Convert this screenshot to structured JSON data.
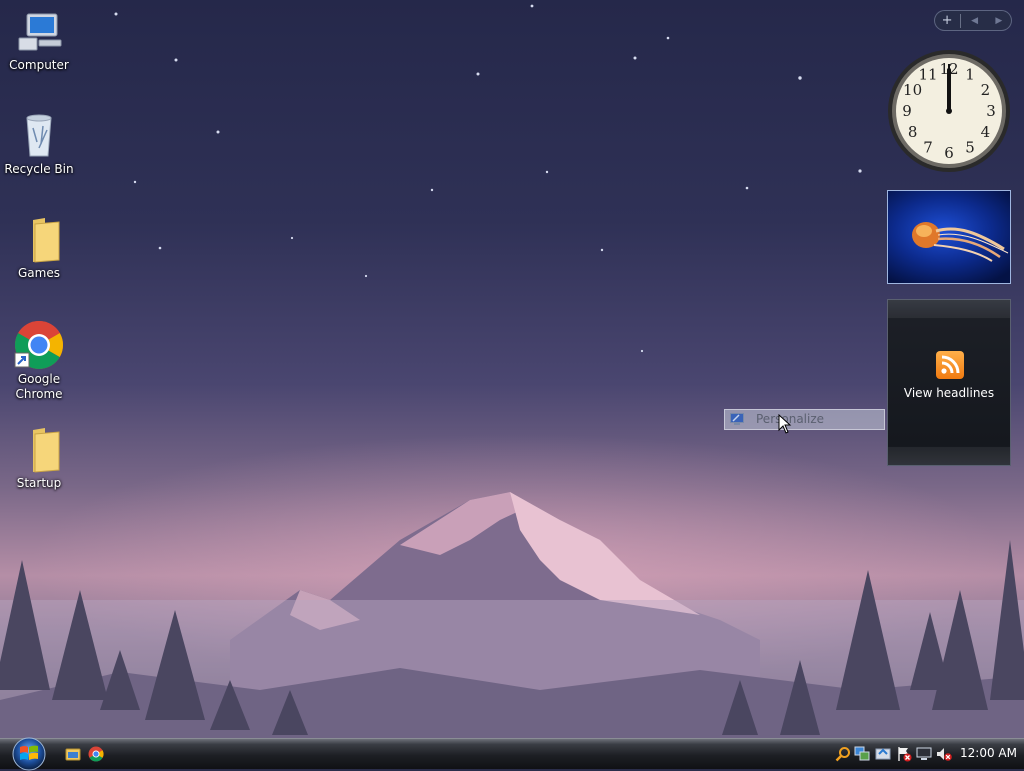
{
  "desktop": {
    "icons": [
      {
        "label": "Computer",
        "icon": "computer-icon"
      },
      {
        "label": "Recycle Bin",
        "icon": "recycle-bin-icon"
      },
      {
        "label": "Games",
        "icon": "folder-icon"
      },
      {
        "label": "Google\nChrome",
        "icon": "chrome-icon"
      },
      {
        "label": "Startup",
        "icon": "folder-icon"
      }
    ]
  },
  "sidebar": {
    "toolbar": {
      "add": "+",
      "prev": "◀",
      "next": "▶"
    },
    "clock": {
      "numerals": [
        "12",
        "1",
        "2",
        "3",
        "4",
        "5",
        "6",
        "7",
        "8",
        "9",
        "10",
        "11"
      ],
      "time": "12:00"
    },
    "slideshow": {
      "icon": "jellyfish-photo"
    },
    "feed": {
      "label": "View headlines",
      "icon": "rss-icon"
    }
  },
  "context_menu": {
    "item": "Personalize",
    "icon": "personalize-icon"
  },
  "taskbar": {
    "start": "start-orb",
    "quick_launch": [
      "explorer-icon",
      "chrome-icon"
    ],
    "tray": [
      "search-icon",
      "network-icon",
      "update-icon",
      "action-center-icon",
      "display-icon",
      "volume-muted-icon"
    ],
    "clock": "12:00 AM"
  },
  "colors": {
    "accent": "#1e4fd6",
    "rss": "#f07a10"
  }
}
